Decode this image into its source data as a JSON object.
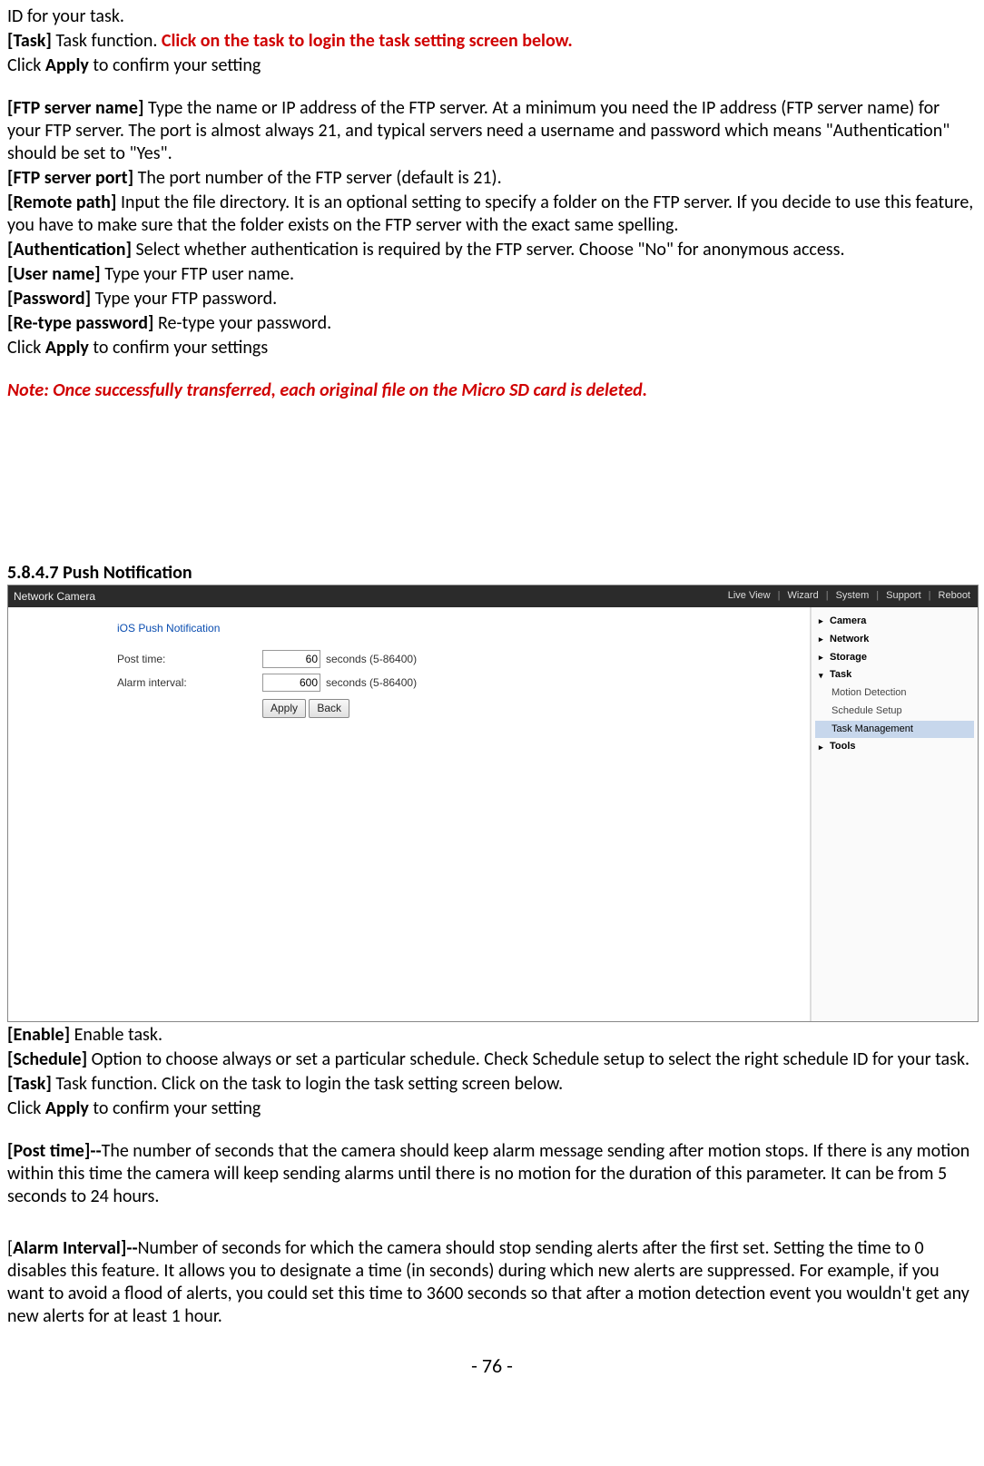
{
  "top": {
    "line1": "ID for your task.",
    "task_label": "[Task]",
    "task_text": " Task function. ",
    "task_red": "Click on the task to login the task setting screen below.",
    "apply_line_pre": "Click ",
    "apply_word": "Apply",
    "apply_line_post": " to confirm your setting",
    "ftp_name_label": "[FTP server name]",
    "ftp_name_text": " Type the name or IP address of the FTP server. At a minimum you need the IP address (FTP server name) for your FTP server. The port is almost always 21, and typical servers need a username and password which means \"Authentication\" should be set to \"Yes\".",
    "ftp_port_label": "[FTP server port]",
    "ftp_port_text": " The port number of the FTP server (default is 21).",
    "remote_label": "[Remote path]",
    "remote_text": " Input the file directory. It is an optional setting to specify a folder on the FTP server. If you decide to use this feature, you have to make sure that the folder exists on the FTP server with the exact same spelling.",
    "auth_label": "[Authentication]",
    "auth_text": " Select whether authentication is required by the FTP server. Choose \"No\" for anonymous access.",
    "user_label": "[User name]",
    "user_text": " Type your FTP user name.",
    "pwd_label": "[Password]",
    "pwd_text": " Type your FTP password.",
    "repwd_label": "[Re-type password]",
    "repwd_text": " Re-type your password.",
    "apply2_pre": "Click ",
    "apply2_word": "Apply",
    "apply2_post": " to confirm your settings",
    "note": "Note: Once successfully transferred, each original file on the Micro SD card is deleted."
  },
  "section_title": "5.8.4.7 Push Notification",
  "screenshot": {
    "header_title": "Network Camera",
    "nav": [
      "Live View",
      "Wizard",
      "System",
      "Support",
      "Reboot"
    ],
    "panel_title": "iOS Push Notification",
    "rows": [
      {
        "label": "Post time:",
        "value": "60",
        "hint": "seconds (5-86400)"
      },
      {
        "label": "Alarm interval:",
        "value": "600",
        "hint": "seconds (5-86400)"
      }
    ],
    "buttons": {
      "apply": "Apply",
      "back": "Back"
    },
    "side": {
      "camera": "Camera",
      "network": "Network",
      "storage": "Storage",
      "task": "Task",
      "task_items": [
        "Motion Detection",
        "Schedule Setup",
        "Task Management"
      ],
      "tools": "Tools"
    }
  },
  "bottom": {
    "enable_label": "[Enable]",
    "enable_text": " Enable task.",
    "schedule_label": "[Schedule]",
    "schedule_text": " Option to choose always or set a particular schedule. Check Schedule setup to select the right schedule ID for your task.",
    "task_label": "[Task]",
    "task_text": " Task function. Click on the task to login the task setting screen below.",
    "apply_pre": "Click ",
    "apply_word": "Apply",
    "apply_post": " to confirm your setting",
    "post_label": "[Post time]--",
    "post_text": "The number of seconds that the camera should keep alarm message sending after motion stops. If there is any motion within this time the camera will keep sending alarms until there is no motion for the duration of this parameter. It can be from 5 seconds to 24 hours.",
    "alarm_pre": "[",
    "alarm_label": "Alarm Interval]--",
    "alarm_text": "Number of seconds for which the camera should stop sending alerts after the first set. Setting the time to 0 disables this feature. It allows you to designate a time (in seconds) during which new alerts are suppressed. For example, if you want to avoid a flood of alerts, you could set this time to 3600 seconds so that after a motion detection event you wouldn't get any new alerts for at least 1 hour."
  },
  "page_number": "- 76 -"
}
